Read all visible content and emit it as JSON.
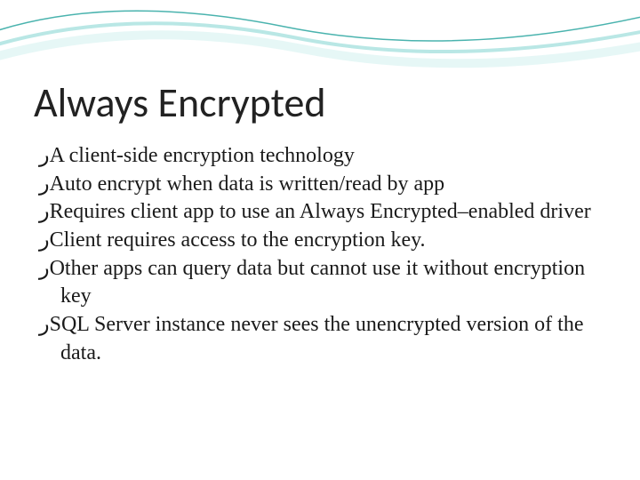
{
  "title": "Always Encrypted",
  "bullet_glyph": "ر",
  "bullets": [
    "A client-side encryption technology",
    "Auto encrypt when data is written/read by app",
    "Requires client app to use an Always Encrypted–enabled driver",
    "Client requires access to the encryption key.",
    "Other apps can query data but cannot use it without encryption key",
    "SQL Server instance never sees the unencrypted version of the data."
  ]
}
